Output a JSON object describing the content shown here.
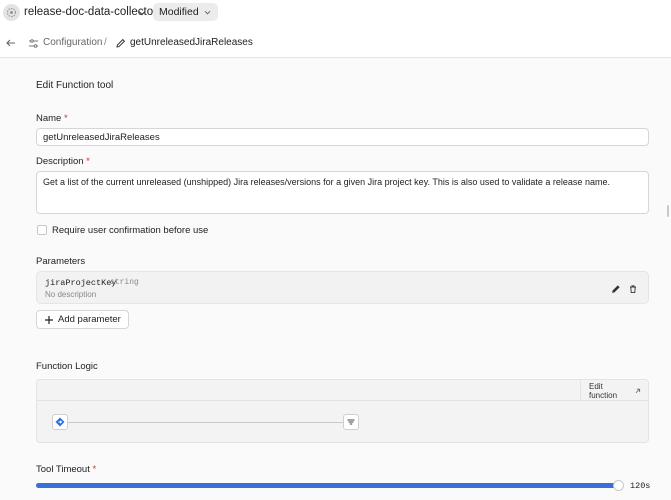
{
  "app": {
    "name": "release-doc-data-collector",
    "status": "Modified",
    "logo_icon": "app-logo-icon"
  },
  "breadcrumb": {
    "configuration": "Configuration",
    "separator": "/",
    "function_name": "getUnreleasedJiraReleases"
  },
  "form": {
    "title": "Edit Function tool",
    "name_label": "Name",
    "name_value": "getUnreleasedJiraReleases",
    "description_label": "Description",
    "description_value": "Get a list of the current unreleased (unshipped) Jira releases/versions for a given Jira project key. This is also used to validate a release name.",
    "required_marker": "*",
    "confirm_label": "Require user confirmation before use",
    "confirm_checked": false
  },
  "parameters": {
    "label": "Parameters",
    "items": [
      {
        "name": "jiraProjectKey",
        "type": "string",
        "description": "No description"
      }
    ],
    "add_label": "Add parameter"
  },
  "logic": {
    "label": "Function Logic",
    "edit_label": "Edit function"
  },
  "timeout": {
    "label": "Tool Timeout",
    "value_label": "120s",
    "fill_fraction": 1.0
  },
  "colors": {
    "accent": "#3b6fd8",
    "required": "#d93025",
    "flow_start": "#2f6fe0"
  }
}
